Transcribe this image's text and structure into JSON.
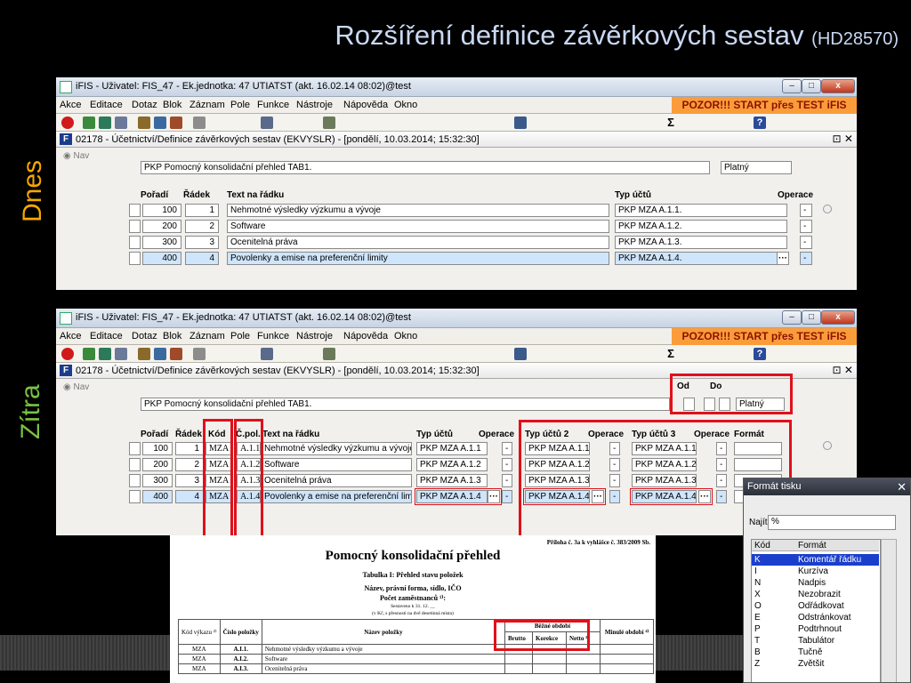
{
  "slide": {
    "title_main": "Rozšíření definice závěrkových sestav",
    "title_code": "(HD28570)",
    "label_today": "Dnes",
    "label_tomorrow": "Zítra",
    "colors": {
      "today": "#f4a800",
      "tomorrow": "#7ac142",
      "highlight": "#e0101a",
      "warning_bg": "#fb9c3a"
    }
  },
  "window": {
    "titlebar": "iFIS - Uživatel: FIS_47 - Ek.jednotka: 47 UTIATST (akt. 16.02.14 08:02)@test",
    "controls": [
      "–",
      "□",
      "x"
    ],
    "menu": [
      "Akce",
      "Editace",
      "Dotaz",
      "Blok",
      "Záznam",
      "Pole",
      "Funkce",
      "Nástroje",
      "Nápověda",
      "Okno"
    ],
    "warning": "POZOR!!!  START přes TEST iFIS",
    "form_title": "02178 - Účetnictví/Definice závěrkových sestav (EKVYSLR) - [pondělí, 10.03.2014; 15:32:30]",
    "form_close": "⊡ ✕",
    "nav": "Nav",
    "sestava": "PKP Pomocný konsolidační přehled TAB1.",
    "status": "Platný",
    "od_label": "Od",
    "do_label": "Do",
    "toolbar_icons": [
      "exit-icon",
      "insert-record-icon",
      "delete-record-icon",
      "query-icon",
      "execute-query-icon",
      "cancel-query-icon",
      "sort-icon",
      "filter-icon",
      "print-icon",
      "save-icon",
      "calculator-icon",
      "sum-icon",
      "help-icon"
    ],
    "toolbar_sum_glyph": "Σ",
    "toolbar_help_glyph": "?"
  },
  "today_grid": {
    "headers": {
      "poradi": "Pořadí",
      "radek": "Řádek",
      "text": "Text na řádku",
      "typ": "Typ účtů",
      "operace": "Operace"
    },
    "rows": [
      {
        "poradi": "100",
        "radek": "1",
        "text": "Nehmotné výsledky výzkumu a vývoje",
        "typ": "PKP MZA A.1.1.",
        "op": "-"
      },
      {
        "poradi": "200",
        "radek": "2",
        "text": "Software",
        "typ": "PKP MZA A.1.2.",
        "op": "-"
      },
      {
        "poradi": "300",
        "radek": "3",
        "text": "Ocenitelná práva",
        "typ": "PKP MZA A.1.3.",
        "op": "-"
      },
      {
        "poradi": "400",
        "radek": "4",
        "text": "Povolenky a emise na preferenční limity",
        "typ": "PKP MZA A.1.4.",
        "op": "-"
      }
    ],
    "lov_button": "···"
  },
  "tomorrow_grid": {
    "headers": {
      "poradi": "Pořadí",
      "radek": "Řádek",
      "kod": "Kód",
      "cpol": "Č.pol.",
      "text": "Text na řádku",
      "typ": "Typ účtů",
      "operace": "Operace",
      "typ2": "Typ účtů 2",
      "operace2": "Operace",
      "typ3": "Typ účtů 3",
      "operace3": "Operace",
      "format": "Formát"
    },
    "rows": [
      {
        "poradi": "100",
        "radek": "1",
        "kod": "MZA",
        "cpol": "A.1.1",
        "text": "Nehmotné výsledky výzkumu a vývoje",
        "typ": "PKP MZA A.1.1",
        "op": "-",
        "typ2": "PKP MZA A.1.1",
        "op2": "-",
        "typ3": "PKP MZA A.1.1",
        "op3": "-"
      },
      {
        "poradi": "200",
        "radek": "2",
        "kod": "MZA",
        "cpol": "A.1.2",
        "text": "Software",
        "typ": "PKP MZA A.1.2",
        "op": "-",
        "typ2": "PKP MZA A.1.2",
        "op2": "-",
        "typ3": "PKP MZA A.1.2",
        "op3": "-"
      },
      {
        "poradi": "300",
        "radek": "3",
        "kod": "MZA",
        "cpol": "A.1.3",
        "text": "Ocenitelná práva",
        "typ": "PKP MZA A.1.3",
        "op": "-",
        "typ2": "PKP MZA A.1.3",
        "op2": "-",
        "typ3": "PKP MZA A.1.3",
        "op3": "-"
      },
      {
        "poradi": "400",
        "radek": "4",
        "kod": "MZA",
        "cpol": "A.1.4",
        "text": "Povolenky a emise na preferenční limity",
        "typ": "PKP MZA A.1.4",
        "op": "-",
        "typ2": "PKP MZA A.1.4",
        "op2": "-",
        "typ3": "PKP MZA A.1.4",
        "op3": "-"
      }
    ],
    "lov_button": "···"
  },
  "report": {
    "appendix": "Příloha č. 3a k vyhlášce č. 383/2009 Sb.",
    "title": "Pomocný konsolidační přehled",
    "table_title": "Tabulka I: Přehled stavu položek",
    "name_line": "Název, právní forma, sídlo, IČO",
    "employees": "Počet zaměstnanců ¹⁾:",
    "date_line": "Sestaveno k 31. 12. __",
    "unit": "(v Kč, s přesností na dvě desetinná místa)",
    "col_kod": "Kód výkazu ²⁾",
    "col_cislo": "Číslo položky",
    "col_nazev": "Název položky",
    "col_bezne": "Běžné období",
    "col_brutto": "Brutto",
    "col_korekce": "Korekce",
    "col_netto": "Netto ³⁾",
    "col_minule": "Minulé období ⁴⁾",
    "rows": [
      {
        "kod": "MZA",
        "cislo": "A.I.1.",
        "nazev": "Nehmotné výsledky výzkumu a vývoje"
      },
      {
        "kod": "MZA",
        "cislo": "A.I.2.",
        "nazev": "Software"
      },
      {
        "kod": "MZA",
        "cislo": "A.I.3.",
        "nazev": "Ocenitelná práva"
      }
    ]
  },
  "format_popup": {
    "title": "Formát tisku",
    "close": "✕",
    "find_label": "Najít",
    "find_value": "%",
    "col_code": "Kód",
    "col_format": "Formát",
    "items": [
      {
        "code": "K",
        "label": "Komentář řádku"
      },
      {
        "code": "I",
        "label": "Kurzíva"
      },
      {
        "code": "N",
        "label": "Nadpis"
      },
      {
        "code": "X",
        "label": "Nezobrazit"
      },
      {
        "code": "O",
        "label": "Odřádkovat"
      },
      {
        "code": "E",
        "label": "Odstránkovat"
      },
      {
        "code": "P",
        "label": "Podtrhnout"
      },
      {
        "code": "T",
        "label": "Tabulátor"
      },
      {
        "code": "B",
        "label": "Tučně"
      },
      {
        "code": "Z",
        "label": "Zvětšit"
      }
    ]
  }
}
